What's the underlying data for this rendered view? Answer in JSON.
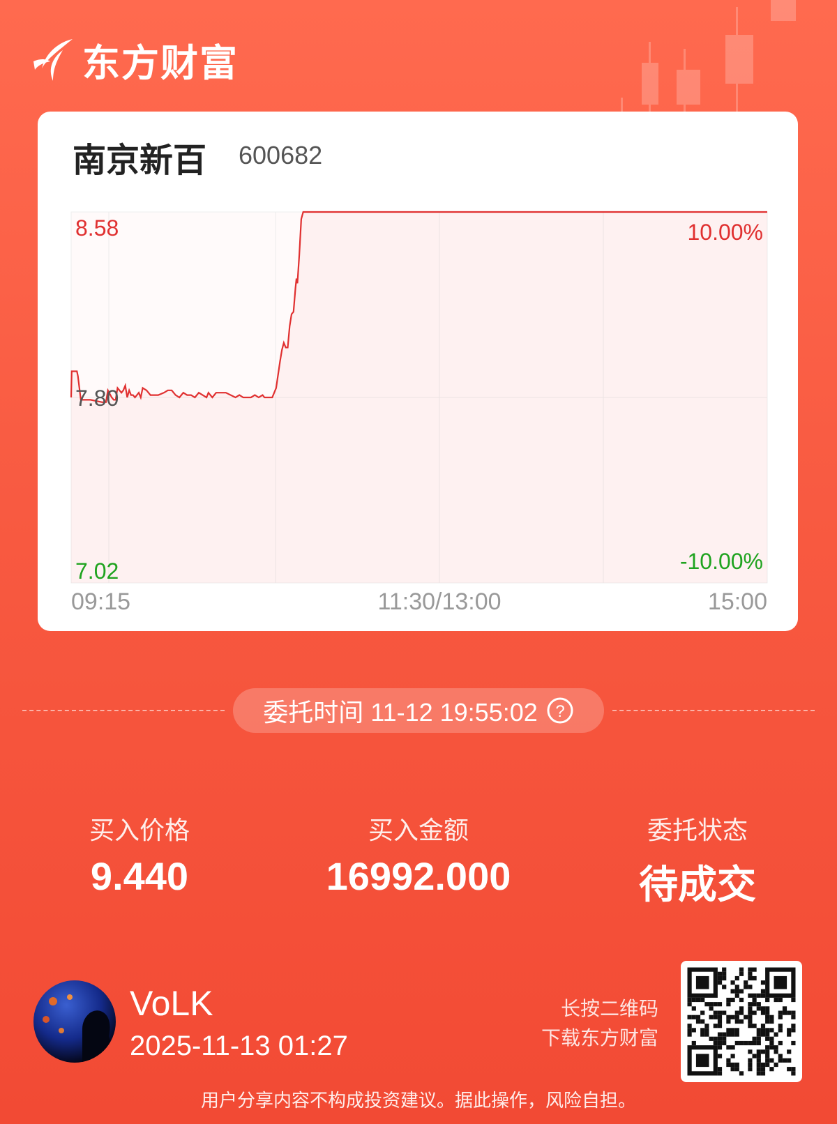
{
  "brand": {
    "name": "东方财富"
  },
  "stock": {
    "name": "南京新百",
    "code": "600682"
  },
  "chart_data": {
    "type": "line",
    "x_start": "09:15",
    "x_mid": "11:30/13:00",
    "x_end": "15:00",
    "ylim": [
      7.02,
      8.58
    ],
    "y_top_label": "8.58",
    "y_mid_label": "7.80",
    "y_bottom_label": "7.02",
    "pct_top_label": "10.00%",
    "pct_bottom_label": "-10.00%",
    "series": [
      {
        "values": [
          [
            0,
            7.8
          ],
          [
            0.3,
            7.91
          ],
          [
            3,
            7.91
          ],
          [
            3.5,
            7.89
          ],
          [
            5,
            7.79
          ],
          [
            10,
            7.79
          ],
          [
            16,
            7.78
          ],
          [
            18,
            7.78
          ],
          [
            19,
            7.83
          ],
          [
            21,
            7.8
          ],
          [
            22,
            7.79
          ],
          [
            23,
            7.79
          ],
          [
            24,
            7.84
          ],
          [
            26,
            7.82
          ],
          [
            27,
            7.83
          ],
          [
            28,
            7.85
          ],
          [
            29,
            7.8
          ],
          [
            30,
            7.83
          ],
          [
            31,
            7.81
          ],
          [
            32,
            7.81
          ],
          [
            33,
            7.8
          ],
          [
            34,
            7.81
          ],
          [
            35,
            7.82
          ],
          [
            36,
            7.8
          ],
          [
            37,
            7.84
          ],
          [
            39,
            7.83
          ],
          [
            41,
            7.81
          ],
          [
            45,
            7.81
          ],
          [
            48,
            7.82
          ],
          [
            50,
            7.83
          ],
          [
            52,
            7.83
          ],
          [
            54,
            7.81
          ],
          [
            56,
            7.8
          ],
          [
            58,
            7.82
          ],
          [
            60,
            7.81
          ],
          [
            62,
            7.81
          ],
          [
            64,
            7.8
          ],
          [
            66,
            7.82
          ],
          [
            68,
            7.81
          ],
          [
            70,
            7.8
          ],
          [
            71,
            7.82
          ],
          [
            73,
            7.8
          ],
          [
            75,
            7.82
          ],
          [
            80,
            7.82
          ],
          [
            85,
            7.8
          ],
          [
            87,
            7.81
          ],
          [
            89,
            7.8
          ],
          [
            91,
            7.8
          ],
          [
            93,
            7.8
          ],
          [
            95,
            7.81
          ],
          [
            97,
            7.8
          ],
          [
            99,
            7.81
          ],
          [
            100,
            7.8
          ],
          [
            101,
            7.8
          ],
          [
            104,
            7.8
          ],
          [
            106,
            7.84
          ],
          [
            108,
            7.95
          ],
          [
            109,
            8.0
          ],
          [
            110,
            8.03
          ],
          [
            111,
            8.01
          ],
          [
            112,
            8.01
          ],
          [
            113,
            8.1
          ],
          [
            114,
            8.15
          ],
          [
            115,
            8.16
          ],
          [
            116,
            8.26
          ],
          [
            116.5,
            8.3
          ],
          [
            117,
            8.28
          ],
          [
            118,
            8.4
          ],
          [
            119,
            8.55
          ],
          [
            120,
            8.58
          ],
          [
            360,
            8.58
          ]
        ]
      }
    ]
  },
  "order": {
    "time_label": "委托时间 11-12 19:55:02",
    "help_glyph": "?",
    "buy_price_label": "买入价格",
    "buy_price": "9.440",
    "buy_amount_label": "买入金额",
    "buy_amount": "16992.000",
    "status_label": "委托状态",
    "status": "待成交"
  },
  "user": {
    "name": "VoLK",
    "timestamp": "2025-11-13 01:27"
  },
  "qr": {
    "hint_line1": "长按二维码",
    "hint_line2": "下载东方财富"
  },
  "disclaimer": "用户分享内容不构成投资建议。据此操作，风险自担。",
  "colors": {
    "up": "#e03030",
    "down": "#1fa31f",
    "accent": "#f85a41"
  }
}
